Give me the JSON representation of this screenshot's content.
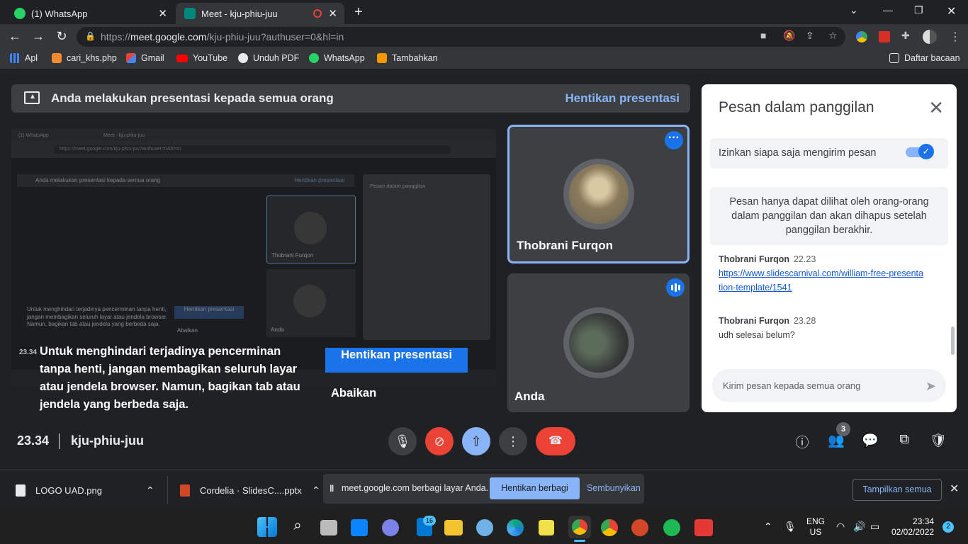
{
  "browser": {
    "tabs": [
      {
        "title": "(1) WhatsApp"
      },
      {
        "title": "Meet - kju-phiu-juu"
      }
    ],
    "new_tab": "+",
    "url_prefix": "https://",
    "url_host": "meet.google.com",
    "url_rest": "/kju-phiu-juu?authuser=0&hl=in",
    "bookmarks": [
      {
        "label": "Apl"
      },
      {
        "label": "cari_khs.php"
      },
      {
        "label": "Gmail"
      },
      {
        "label": "YouTube"
      },
      {
        "label": "Unduh PDF"
      },
      {
        "label": "WhatsApp"
      },
      {
        "label": "Tambahkan"
      }
    ],
    "reading_list": "Daftar bacaan"
  },
  "meet": {
    "present_banner": "Anda melakukan presentasi kepada semua orang",
    "stop_presenting": "Hentikan presentasi",
    "warning_text": "Untuk menghindari terjadinya pencerminan tanpa henti, jangan membagikan seluruh layar atau jendela browser. Namun, bagikan tab atau jendela yang berbeda saja.",
    "warning_count": "23.34",
    "stop_presenting_button": "Hentikan presentasi",
    "ignore_button": "Abaikan",
    "participants": [
      {
        "name": "Thobrani Furqon"
      },
      {
        "name": "Anda"
      }
    ],
    "time": "23.34",
    "separator": "|",
    "meeting_code": "kju-phiu-juu",
    "people_count": "3"
  },
  "preview": {
    "tab1": "(1) WhatsApp",
    "tab2": "Meet - kju-phiu-juu",
    "url": "https://meet.google.com/kju-phiu-juu?authuser=0&hl=in",
    "banner": "Anda melakukan presentasi kepada semua orang",
    "banner_stop": "Hentikan presentasi",
    "chat_title": "Pesan dalam panggilan",
    "tile1": "Thobrani Furqon",
    "tile2": "Anda",
    "warning": "Untuk menghindari terjadinya pencerminan tanpa henti, jangan membagikan seluruh layar atau jendela browser. Namun, bagikan tab atau jendela yang berbeda saja.",
    "btn": "Hentikan presentasi",
    "ignore": "Abaikan"
  },
  "chat": {
    "title": "Pesan dalam panggilan",
    "allow_label": "Izinkan siapa saja mengirim pesan",
    "allow_enabled": true,
    "info": "Pesan hanya dapat dilihat oleh orang-orang dalam panggilan dan akan dihapus setelah panggilan berakhir.",
    "messages": [
      {
        "sender": "Thobrani Furqon",
        "time": "22.23",
        "text": "https://www.slidescarnival.com/william-free-presentation-template/1541",
        "is_link": true
      },
      {
        "sender": "Thobrani Furqon",
        "time": "23.28",
        "text": "udh selesai belum?",
        "is_link": false
      }
    ],
    "input_placeholder": "Kirim pesan kepada semua orang"
  },
  "downloads": {
    "items": [
      {
        "name": "LOGO UAD.png"
      },
      {
        "name": "Cordelia · SlidesC....pptx"
      }
    ],
    "share_message": "meet.google.com berbagi layar Anda.",
    "stop_sharing": "Hentikan berbagi",
    "hide": "Sembunyikan",
    "show_all": "Tampilkan semua"
  },
  "taskbar": {
    "lang_top": "ENG",
    "lang_bottom": "US",
    "time": "23:34",
    "date": "02/02/2022",
    "notifications": "2",
    "store_badge": "16"
  },
  "colors": {
    "accent_blue": "#1a73e8",
    "light_blue": "#8ab4f8",
    "end_call_red": "#ea4335",
    "meet_bg": "#202124"
  }
}
